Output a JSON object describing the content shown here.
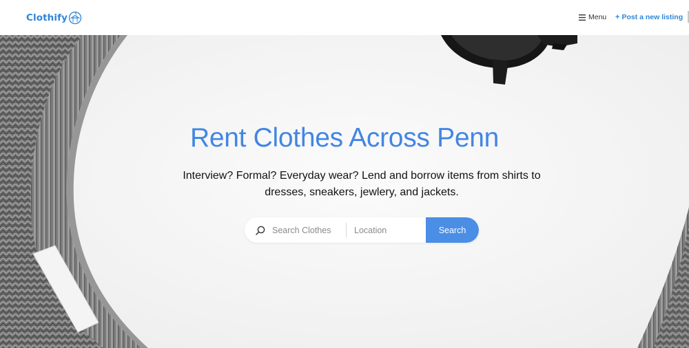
{
  "brand": {
    "name": "Clothify",
    "color": "#2f86d8"
  },
  "nav": {
    "menu_icon": "hamburger-icon",
    "menu_label": "Menu",
    "post_icon": "plus-icon",
    "post_label": "Post a new listing"
  },
  "hero": {
    "title": "Rent Clothes Across Penn",
    "description": "Interview? Formal? Everyday wear? Lend and borrow items from shirts to dresses, sneakers, jewlery, and jackets.",
    "title_color": "#4286e2",
    "background_image": "knit-sweater-and-sunglasses-photo"
  },
  "search": {
    "icon": "search-icon",
    "query_placeholder": "Search Clothes",
    "query_value": "",
    "location_placeholder": "Location",
    "location_value": "",
    "button_label": "Search",
    "button_color": "#4a8ee6"
  }
}
